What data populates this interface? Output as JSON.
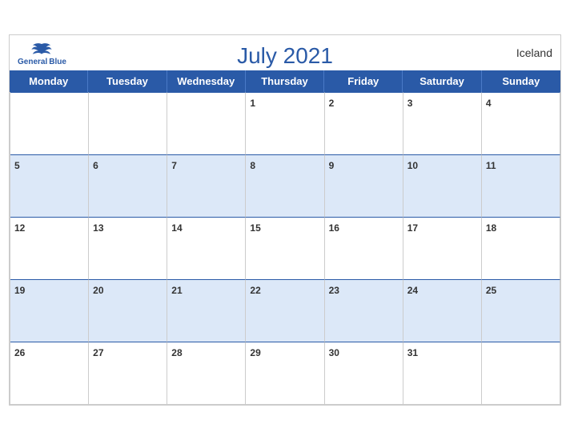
{
  "calendar": {
    "title": "July 2021",
    "country": "Iceland",
    "logo": {
      "general": "General",
      "blue": "Blue"
    },
    "days": [
      "Monday",
      "Tuesday",
      "Wednesday",
      "Thursday",
      "Friday",
      "Saturday",
      "Sunday"
    ],
    "rows": [
      [
        "",
        "",
        "",
        "1",
        "2",
        "3",
        "4"
      ],
      [
        "5",
        "6",
        "7",
        "8",
        "9",
        "10",
        "11"
      ],
      [
        "12",
        "13",
        "14",
        "15",
        "16",
        "17",
        "18"
      ],
      [
        "19",
        "20",
        "21",
        "22",
        "23",
        "24",
        "25"
      ],
      [
        "26",
        "27",
        "28",
        "29",
        "30",
        "31",
        ""
      ]
    ]
  }
}
